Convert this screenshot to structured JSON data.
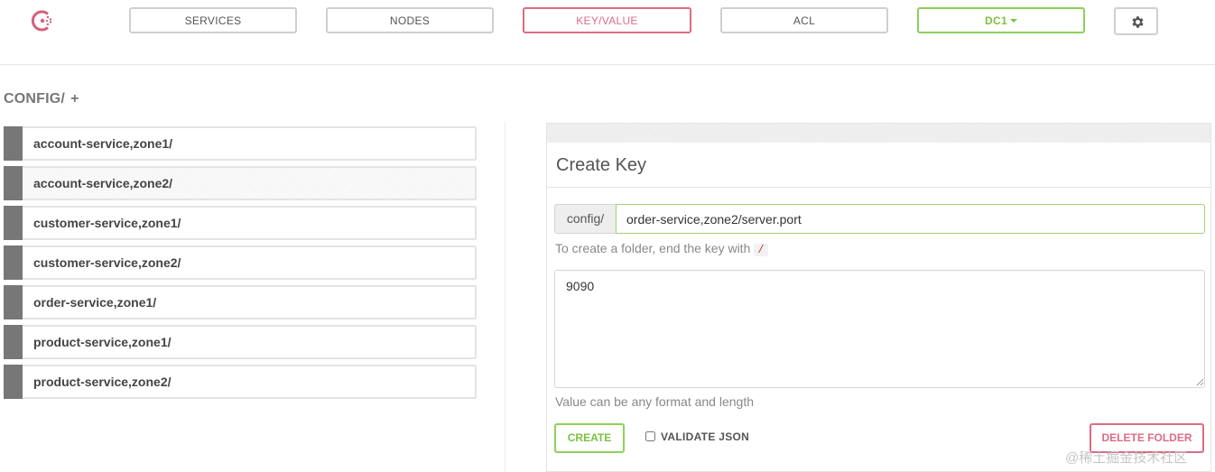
{
  "nav": {
    "items": [
      {
        "label": "SERVICES"
      },
      {
        "label": "NODES"
      },
      {
        "label": "KEY/VALUE"
      },
      {
        "label": "ACL"
      }
    ],
    "active": "KEY/VALUE",
    "datacenter": "DC1",
    "settings_icon": "gear-icon",
    "logo_icon": "consul-logo-icon",
    "colors": {
      "accent": "#dd6b85",
      "green": "#7cc143",
      "border": "#cfcfcf"
    }
  },
  "breadcrumb": {
    "path": "CONFIG/",
    "add": "+"
  },
  "folders": [
    {
      "label": "account-service,zone1/"
    },
    {
      "label": "account-service,zone2/"
    },
    {
      "label": "customer-service,zone1/"
    },
    {
      "label": "customer-service,zone2/"
    },
    {
      "label": "order-service,zone1/"
    },
    {
      "label": "product-service,zone1/"
    },
    {
      "label": "product-service,zone2/"
    }
  ],
  "create_key": {
    "title": "Create Key",
    "prefix": "config/",
    "key_value": "order-service,zone2/server.port",
    "folder_help": "To create a folder, end the key with",
    "folder_help_code": "/",
    "value": "9090",
    "value_help": "Value can be any format and length",
    "create_label": "CREATE",
    "validate_label": "VALIDATE JSON",
    "validate_checked": false,
    "delete_label": "DELETE FOLDER"
  },
  "watermark": "@稀土掘金技术社区"
}
